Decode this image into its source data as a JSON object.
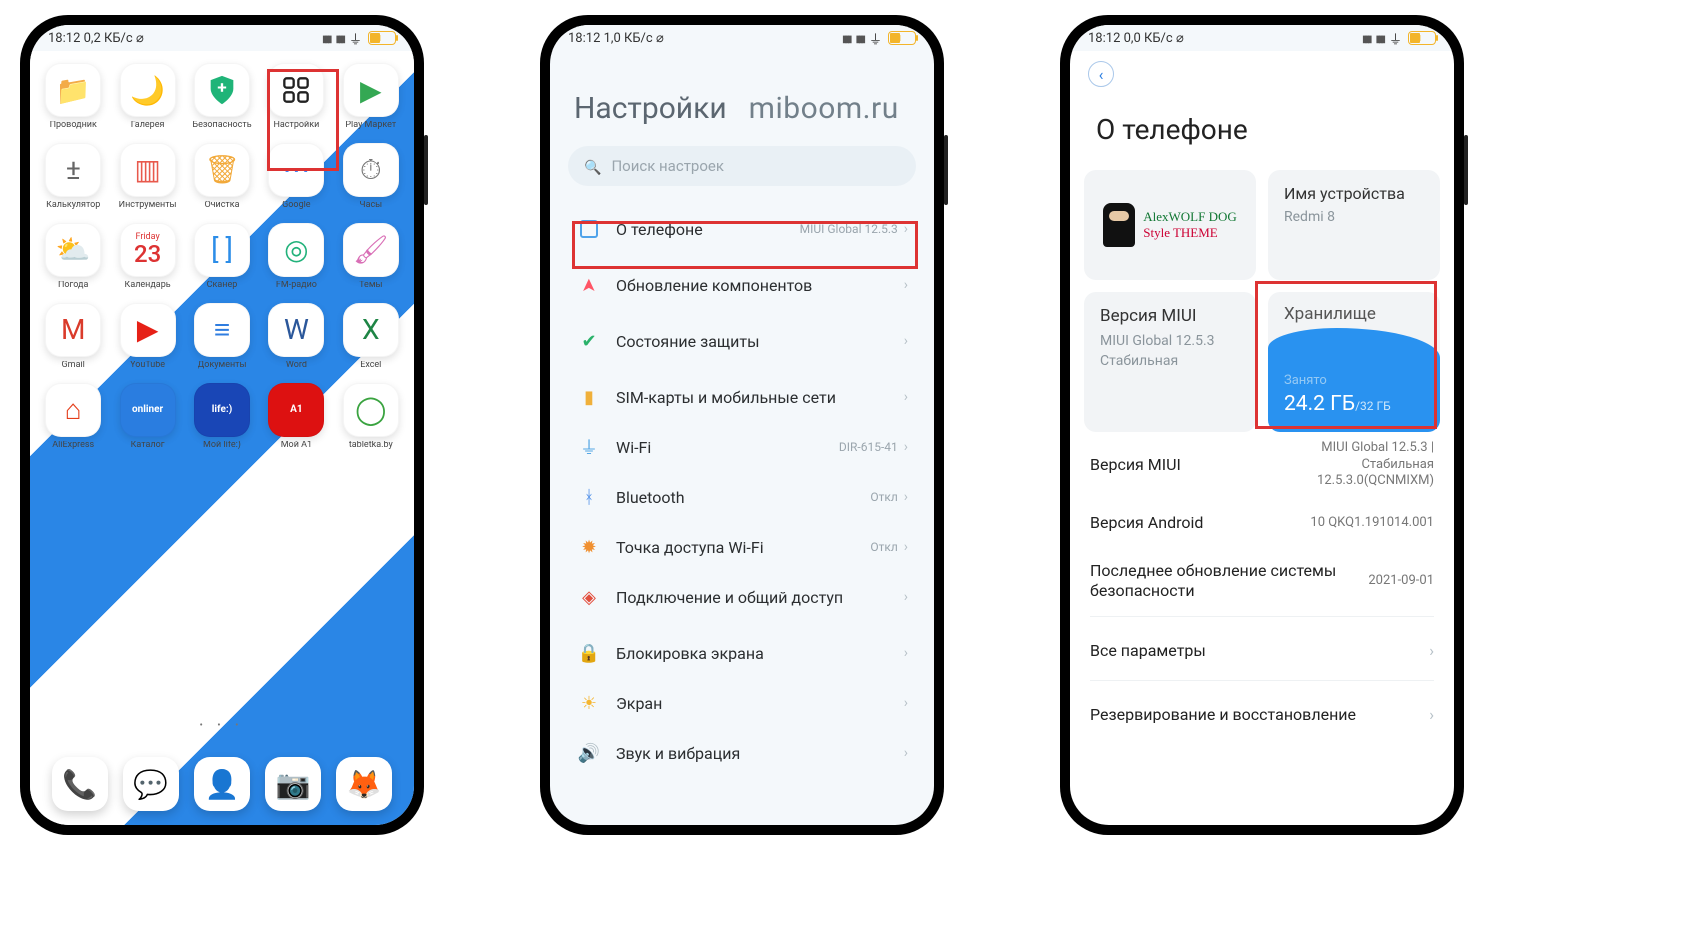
{
  "status": {
    "time": "18:12",
    "speed1": "0,2 КБ/с",
    "speed2": "1,0 КБ/с",
    "speed3": "0,0 КБ/с",
    "batt": "41"
  },
  "phone1": {
    "apps": [
      {
        "name": "Проводник",
        "icon": "📁",
        "tint": "#f6a23e"
      },
      {
        "name": "Галерея",
        "icon": "🌙",
        "tint": "#6d4fd8"
      },
      {
        "name": "Безопасность",
        "icon": "＋",
        "tint": "#1fb478",
        "chip": true,
        "chiptext": "+",
        "badge_shield": true
      },
      {
        "name": "Настройки",
        "icon": "⠶",
        "tint": "#111",
        "hl": true,
        "settings": true
      },
      {
        "name": "Play Маркет",
        "icon": "▶",
        "tint": "#34a853"
      },
      {
        "name": "Калькулятор",
        "icon": "±",
        "tint": "#666",
        "calc": true
      },
      {
        "name": "Инструменты",
        "icon": "▥",
        "tint": "#e8594c"
      },
      {
        "name": "Очистка",
        "icon": "🗑",
        "tint": "#f2a93a"
      },
      {
        "name": "Google",
        "icon": "⋯",
        "tint": "#4285f4"
      },
      {
        "name": "Часы",
        "icon": "⏱",
        "tint": "#777"
      },
      {
        "name": "Погода",
        "icon": "⛅",
        "tint": "#3aa3ea"
      },
      {
        "name": "Календарь",
        "icon": "",
        "calendar": true,
        "day": "Friday",
        "date": "23"
      },
      {
        "name": "Сканер",
        "icon": "[ ]",
        "tint": "#2c8de8"
      },
      {
        "name": "FM-радио",
        "icon": "◎",
        "tint": "#22b27b"
      },
      {
        "name": "Темы",
        "icon": "🖌",
        "tint": "#d96fb6"
      },
      {
        "name": "Gmail",
        "icon": "M",
        "tint": "#da3b2b"
      },
      {
        "name": "YouTube",
        "icon": "▶",
        "tint": "#e62117"
      },
      {
        "name": "Документы",
        "icon": "≡",
        "tint": "#2f7de0"
      },
      {
        "name": "Word",
        "icon": "W",
        "tint": "#2b579a"
      },
      {
        "name": "Excel",
        "icon": "X",
        "tint": "#1e8545"
      },
      {
        "name": "AliExpress",
        "icon": "⌂",
        "tint": "#e43d1a"
      },
      {
        "name": "Каталог",
        "icon": "onliner",
        "tint": "#2a7de0",
        "text": true
      },
      {
        "name": "Мой life:)",
        "icon": "life:)",
        "tint": "#1946b6",
        "text": true
      },
      {
        "name": "Мой А1",
        "icon": "A1",
        "tint": "#d11",
        "text": true
      },
      {
        "name": "tabletka.by",
        "icon": "◯",
        "tint": "#3aa340"
      }
    ],
    "dock": [
      {
        "name": "Телефон",
        "icon": "📞",
        "tint": "#2c76e0"
      },
      {
        "name": "Сообщения",
        "icon": "💬",
        "tint": "#2c76e0"
      },
      {
        "name": "Контакты",
        "icon": "👤",
        "tint": "#2c76e0"
      },
      {
        "name": "Камера",
        "icon": "📷",
        "tint": "#222"
      },
      {
        "name": "Firefox",
        "icon": "🦊",
        "tint": "#f57c00"
      }
    ]
  },
  "phone2": {
    "title": "Настройки",
    "watermark": "miboom.ru",
    "search": "Поиск настроек",
    "items": [
      {
        "label": "О телефоне",
        "sub": "MIUI Global 12.5.3",
        "hl": true,
        "ic": "sq",
        "col": "#4fa3ea"
      },
      {
        "label": "Обновление компонентов",
        "ic": "up",
        "cls": "ic-up",
        "glyph": "➤",
        "sep": true
      },
      {
        "label": "Состояние защиты",
        "glyph": "✔",
        "cls": "ic-shield",
        "sep": true
      },
      {
        "label": "SIM-карты и мобильные сети",
        "glyph": "▮",
        "cls": "ic-sim",
        "sep": true
      },
      {
        "label": "Wi-Fi",
        "sub": "DIR-615-41",
        "glyph": "⏚",
        "cls": "ic-wifi"
      },
      {
        "label": "Bluetooth",
        "sub": "Откл",
        "glyph": "ᚼ",
        "cls": "ic-bt"
      },
      {
        "label": "Точка доступа Wi-Fi",
        "sub": "Откл",
        "glyph": "✹",
        "cls": "ic-hs"
      },
      {
        "label": "Подключение и общий доступ",
        "glyph": "◈",
        "cls": "ic-share"
      },
      {
        "label": "Блокировка экрана",
        "glyph": "🔒",
        "cls": "ic-lock",
        "sep": true
      },
      {
        "label": "Экран",
        "glyph": "☀",
        "cls": "ic-sun"
      },
      {
        "label": "Звук и вибрация",
        "glyph": "🔊",
        "cls": "ic-snd"
      }
    ]
  },
  "phone3": {
    "title": "О телефоне",
    "theme_line1": "AlexWOLF DOG",
    "theme_line2": "Style THEME",
    "device_name_label": "Имя устройства",
    "device_name": "Redmi 8",
    "miui_label": "Версия MIUI",
    "miui_value": "MIUI Global 12.5.3 Стабильная",
    "storage_label": "Хранилище",
    "storage_used_label": "Занято",
    "storage_used": "24.2 ГБ",
    "storage_total": "/32 ГБ",
    "rows": [
      {
        "l": "Версия MIUI",
        "r": "MIUI Global 12.5.3 | Стабильная 12.5.3.0(QCNMIXM)"
      },
      {
        "l": "Версия Android",
        "r": "10 QKQ1.191014.001"
      },
      {
        "l": "Последнее обновление системы безопасности",
        "r": "2021-09-01"
      },
      {
        "l": "Все параметры",
        "chev": true,
        "sep": true
      },
      {
        "l": "Резервирование и восстановление",
        "chev": true,
        "sep": true
      }
    ]
  }
}
